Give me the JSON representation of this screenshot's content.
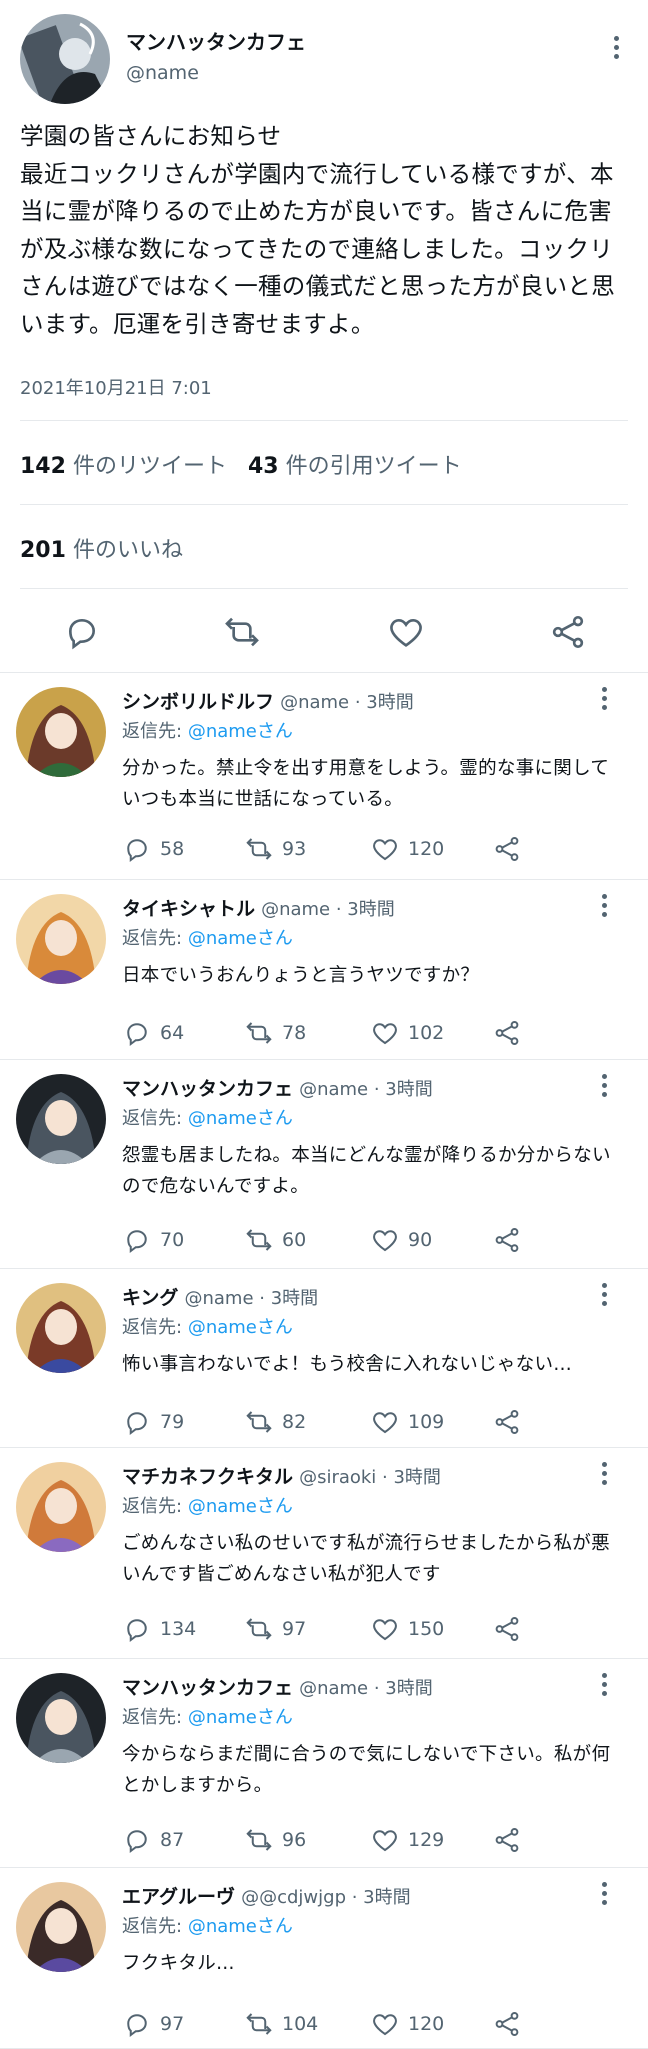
{
  "tweet": {
    "display_name": "マンハッタンカフェ",
    "handle": "@name",
    "body": "学園の皆さんにお知らせ\n最近コックリさんが学園内で流行している様ですが、本当に霊が降りるので止めた方が良いです。皆さんに危害が及ぶ様な数になってきたので連絡しました。コックリさんは遊びではなく一種の儀式だと思った方が良いと思います。厄運を引き寄せますよ。",
    "timestamp": "2021年10月21日 7:01",
    "retweets_count": "142",
    "retweets_label": "件のリツイート",
    "quotes_count": "43",
    "quotes_label": "件の引用ツイート",
    "likes_count": "201",
    "likes_label": "件のいいね"
  },
  "replies": [
    {
      "name": "シンボリルドルフ",
      "meta": "@name · 3時間",
      "to_label": "返信先:",
      "to": "@nameさん",
      "text": "分かった。禁止令を出す用意をしよう。霊的な事に関していつも本当に世話になっている。",
      "replies": "58",
      "retweets": "93",
      "likes": "120",
      "avatar_colors": [
        "#6b3a2a",
        "#2f6b3a",
        "#c9a24a"
      ]
    },
    {
      "name": "タイキシャトル",
      "meta": "@name · 3時間",
      "to_label": "返信先:",
      "to": "@nameさん",
      "text": "日本でいうおんりょうと言うヤツですか？",
      "replies": "64",
      "retweets": "78",
      "likes": "102",
      "avatar_colors": [
        "#d98a3a",
        "#6a4aa0",
        "#f2d7a8"
      ]
    },
    {
      "name": "マンハッタンカフェ",
      "meta": "@name · 3時間",
      "to_label": "返信先:",
      "to": "@nameさん",
      "text": "怨霊も居ましたね。本当にどんな霊が降りるか分からないので危ないんですよ。",
      "replies": "70",
      "retweets": "60",
      "likes": "90",
      "avatar_colors": [
        "#4a5560",
        "#9aa6b0",
        "#1e2328"
      ]
    },
    {
      "name": "キング",
      "meta": "@name · 3時間",
      "to_label": "返信先:",
      "to": "@nameさん",
      "text": "怖い事言わないでよ！もう校舎に入れないじゃない…",
      "replies": "79",
      "retweets": "82",
      "likes": "109",
      "avatar_colors": [
        "#7a3a28",
        "#3a4aa0",
        "#e0c080"
      ]
    },
    {
      "name": "マチカネフクキタル",
      "meta": "@siraoki · 3時間",
      "to_label": "返信先:",
      "to": "@nameさん",
      "text": "ごめんなさい私のせいです私が流行らせましたから私が悪いんです皆ごめんなさい私が犯人です",
      "replies": "134",
      "retweets": "97",
      "likes": "150",
      "avatar_colors": [
        "#d07a3a",
        "#8a6ac0",
        "#f0d0a0"
      ]
    },
    {
      "name": "マンハッタンカフェ",
      "meta": "@name · 3時間",
      "to_label": "返信先:",
      "to": "@nameさん",
      "text": "今からならまだ間に合うので気にしないで下さい。私が何とかしますから。",
      "replies": "87",
      "retweets": "96",
      "likes": "129",
      "avatar_colors": [
        "#4a5560",
        "#9aa6b0",
        "#1e2328"
      ]
    },
    {
      "name": "エアグルーヴ",
      "meta": "@@cdjwjgp · 3時間",
      "to_label": "返信先:",
      "to": "@nameさん",
      "text": "フクキタル…",
      "replies": "97",
      "retweets": "104",
      "likes": "120",
      "avatar_colors": [
        "#3a2a28",
        "#5a4aa0",
        "#e8c8a0"
      ]
    }
  ],
  "icons": {
    "reply": "reply-icon",
    "retweet": "retweet-icon",
    "like": "heart-icon",
    "share": "share-icon",
    "more": "more-icon"
  },
  "colors": {
    "text": "#0f1419",
    "secondary": "#536471",
    "mention": "#1d9bf0",
    "divider": "#e6e9ec"
  }
}
